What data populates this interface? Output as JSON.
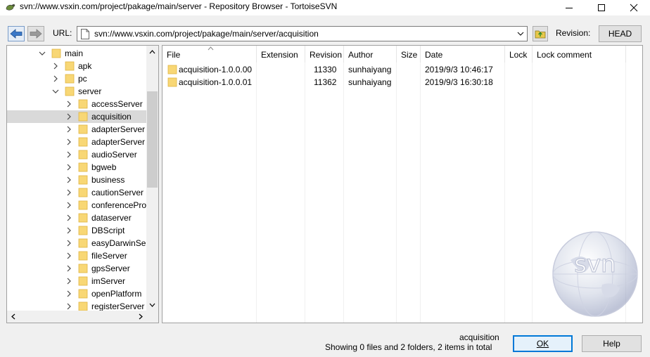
{
  "window": {
    "title": "svn://www.vsxin.com/project/pakage/main/server - Repository Browser - TortoiseSVN"
  },
  "toolbar": {
    "url_label": "URL:",
    "url_value": "svn://www.vsxin.com/project/pakage/main/server/acquisition",
    "revision_label": "Revision:",
    "revision_button": "HEAD"
  },
  "tree": {
    "items": [
      {
        "label": "main",
        "expanded": true
      },
      {
        "label": "apk",
        "expanded": false
      },
      {
        "label": "pc",
        "expanded": false
      },
      {
        "label": "server",
        "expanded": true
      },
      {
        "label": "accessServer",
        "expanded": false
      },
      {
        "label": "acquisition",
        "expanded": false,
        "selected": true
      },
      {
        "label": "adapterServer",
        "expanded": false
      },
      {
        "label": "adapterServer",
        "expanded": false
      },
      {
        "label": "audioServer",
        "expanded": false
      },
      {
        "label": "bgweb",
        "expanded": false
      },
      {
        "label": "business",
        "expanded": false
      },
      {
        "label": "cautionServer",
        "expanded": false
      },
      {
        "label": "conferencePro",
        "expanded": false
      },
      {
        "label": "dataserver",
        "expanded": false
      },
      {
        "label": "DBScript",
        "expanded": false
      },
      {
        "label": "easyDarwinSer",
        "expanded": false
      },
      {
        "label": "fileServer",
        "expanded": false
      },
      {
        "label": "gpsServer",
        "expanded": false
      },
      {
        "label": "imServer",
        "expanded": false
      },
      {
        "label": "openPlatform",
        "expanded": false
      },
      {
        "label": "registerServer",
        "expanded": false
      }
    ]
  },
  "list": {
    "columns": [
      "File",
      "Extension",
      "Revision",
      "Author",
      "Size",
      "Date",
      "Lock",
      "Lock comment"
    ],
    "rows": [
      {
        "file": "acquisition-1.0.0.00",
        "extension": "",
        "revision": "11330",
        "author": "sunhaiyang",
        "size": "",
        "date": "2019/9/3 10:46:17",
        "lock": "",
        "lock_comment": ""
      },
      {
        "file": "acquisition-1.0.0.01",
        "extension": "",
        "revision": "11362",
        "author": "sunhaiyang",
        "size": "",
        "date": "2019/9/3 16:30:18",
        "lock": "",
        "lock_comment": ""
      }
    ],
    "watermark": "svn"
  },
  "status": {
    "selected_name": "acquisition",
    "summary": "Showing 0 files and 2 folders, 2 items in total"
  },
  "buttons": {
    "ok": "OK",
    "help": "Help"
  },
  "colors": {
    "folder": "#f8d775",
    "selection": "#d9d9d9",
    "accent": "#0078d7"
  }
}
